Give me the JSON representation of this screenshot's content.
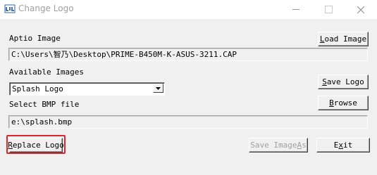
{
  "window": {
    "title": "Change Logo",
    "icon": "app-logo-icon",
    "controls": [
      "minimize-icon",
      "maximize-icon",
      "close-icon"
    ]
  },
  "aptio": {
    "label": "Aptio Image",
    "path": "C:\\Users\\智乃\\Desktop\\PRIME-B450M-K-ASUS-3211.CAP",
    "load_button": {
      "prefix": "",
      "key": "L",
      "rest": "oad Image"
    }
  },
  "images": {
    "label": "Available Images",
    "selected": "Splash Logo",
    "save_button": {
      "prefix": "",
      "key": "S",
      "rest": "ave Logo"
    }
  },
  "bmp": {
    "label": "Select BMP file",
    "path": "e:\\splash.bmp",
    "browse_button": {
      "prefix": "",
      "key": "B",
      "rest": "rowse"
    }
  },
  "actions": {
    "replace_button": {
      "prefix": "",
      "key": "R",
      "rest": "eplace Logo"
    },
    "save_image_as_button": {
      "prefix": "Save Image ",
      "key": "A",
      "rest": "s"
    },
    "exit_button": {
      "prefix": "E",
      "key": "x",
      "rest": "it"
    }
  },
  "colors": {
    "highlight": "#e0262a",
    "disabled_text": "#a0a0a0"
  }
}
